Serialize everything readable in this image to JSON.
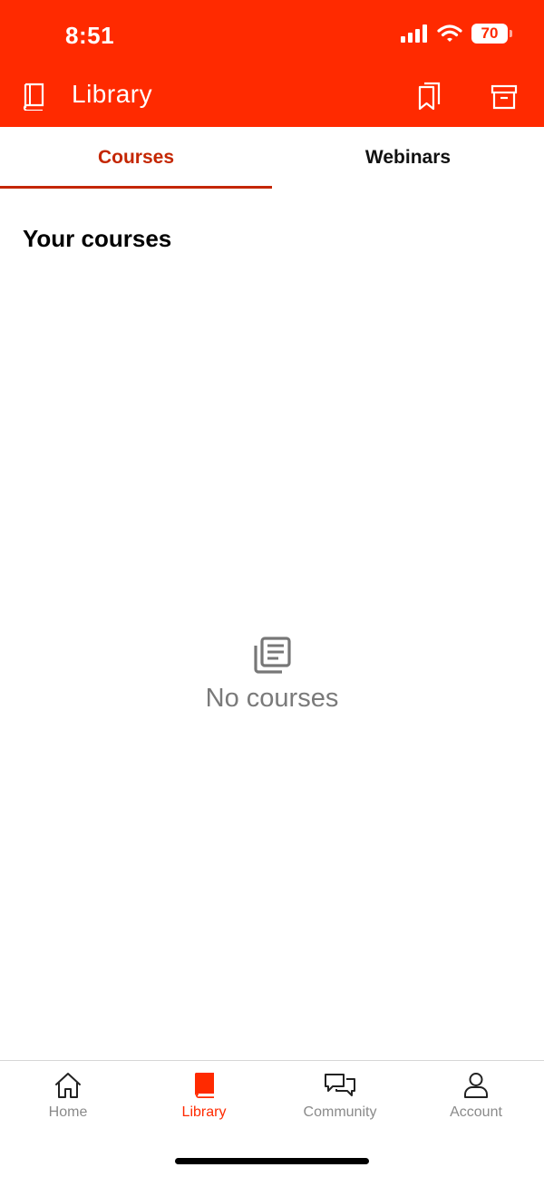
{
  "status_bar": {
    "time": "8:51",
    "battery": "70"
  },
  "header": {
    "title": "Library"
  },
  "tabs": [
    {
      "label": "Courses",
      "active": true
    },
    {
      "label": "Webinars",
      "active": false
    }
  ],
  "main": {
    "section_title": "Your courses",
    "empty_message": "No courses"
  },
  "bottom_nav": {
    "items": [
      {
        "label": "Home",
        "icon": "home-icon"
      },
      {
        "label": "Library",
        "icon": "book-icon",
        "active": true
      },
      {
        "label": "Community",
        "icon": "chat-icon"
      },
      {
        "label": "Account",
        "icon": "person-icon"
      }
    ]
  },
  "colors": {
    "brand": "#ff2a00",
    "active_tab": "#c42600",
    "muted": "#7a7a7a"
  }
}
